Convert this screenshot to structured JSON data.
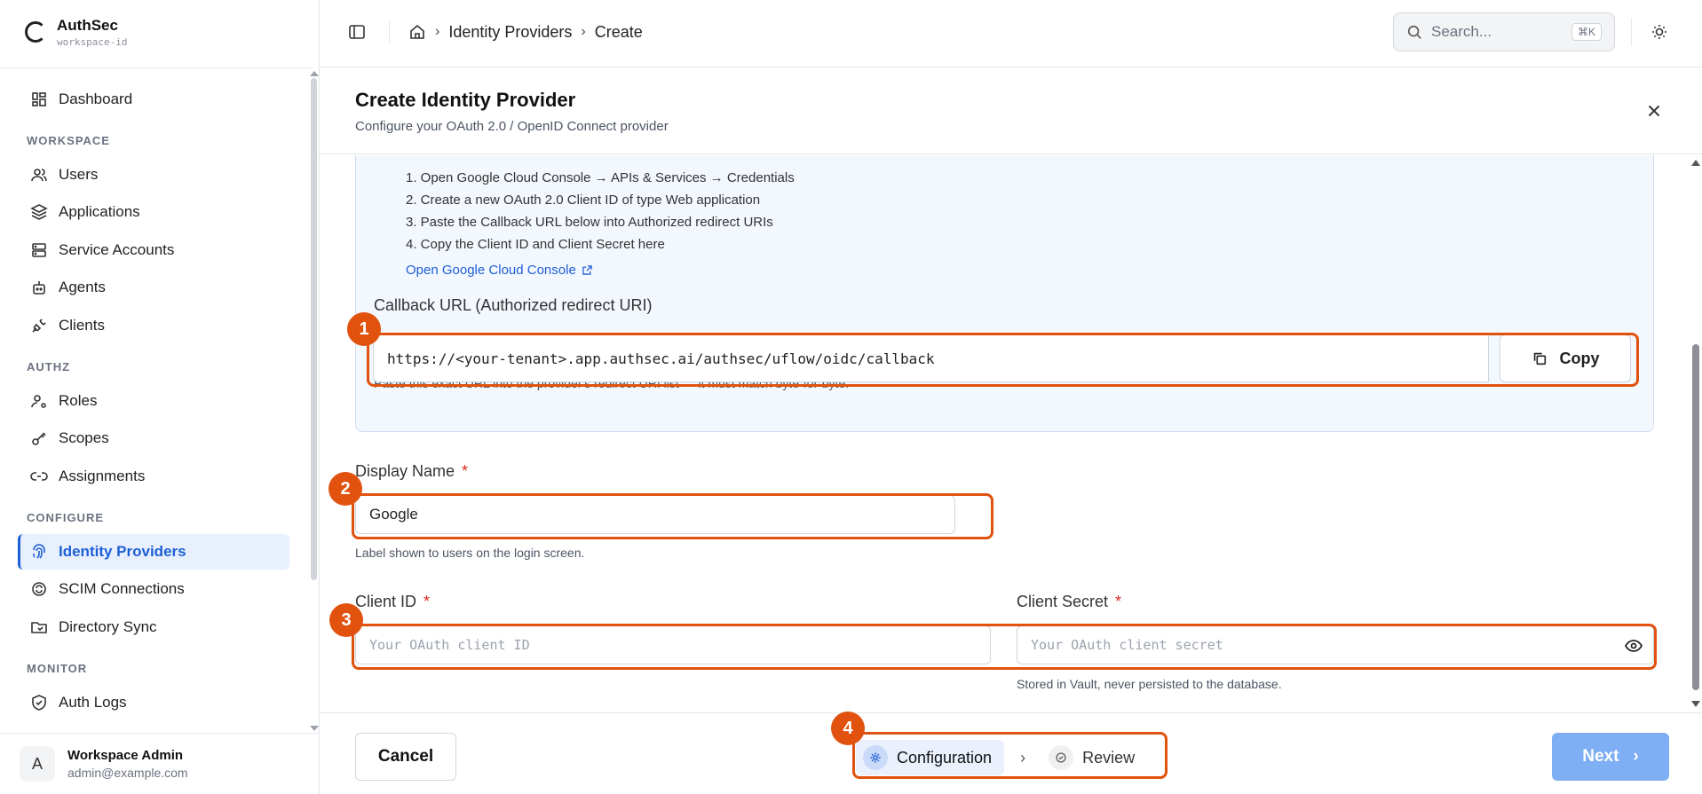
{
  "brand": {
    "name": "AuthSec",
    "workspace": "workspace-id"
  },
  "sidebar": {
    "dashboard": "Dashboard",
    "sections": {
      "workspace": "WORKSPACE",
      "authz": "AUTHZ",
      "configure": "CONFIGURE",
      "monitor": "MONITOR"
    },
    "items": {
      "users": "Users",
      "applications": "Applications",
      "service_accounts": "Service Accounts",
      "agents": "Agents",
      "clients": "Clients",
      "roles": "Roles",
      "scopes": "Scopes",
      "assignments": "Assignments",
      "identity_providers": "Identity Providers",
      "scim": "SCIM Connections",
      "directory_sync": "Directory Sync",
      "auth_logs": "Auth Logs"
    },
    "user": {
      "initial": "A",
      "name": "Workspace Admin",
      "email": "admin@example.com"
    }
  },
  "header": {
    "breadcrumb": [
      "Identity Providers",
      "Create"
    ],
    "search": {
      "placeholder": "Search...",
      "shortcut": "⌘K"
    }
  },
  "dialog": {
    "title": "Create Identity Provider",
    "subtitle": "Configure your OAuth 2.0 / OpenID Connect provider",
    "steps": [
      "1. Open Google Cloud Console → APIs & Services → Credentials",
      "2. Create a new OAuth 2.0 Client ID of type Web application",
      "3. Paste the Callback URL below into Authorized redirect URIs",
      "4. Copy the Client ID and Client Secret here"
    ],
    "console_link": "Open Google Cloud Console",
    "callback": {
      "label": "Callback URL (Authorized redirect URI)",
      "value": "https://<your-tenant>.app.authsec.ai/authsec/uflow/oidc/callback",
      "copy_label": "Copy",
      "hint": "Paste this exact URL into the provider's redirect URI list — it must match byte-for-byte."
    },
    "display_name": {
      "label": "Display Name",
      "required": "*",
      "value": "Google",
      "hint": "Label shown to users on the login screen."
    },
    "client_id": {
      "label": "Client ID",
      "required": "*",
      "placeholder": "Your OAuth client ID"
    },
    "client_secret": {
      "label": "Client Secret",
      "required": "*",
      "placeholder": "Your OAuth client secret",
      "hint": "Stored in Vault, never persisted to the database."
    }
  },
  "footer": {
    "cancel": "Cancel",
    "wizard_steps": [
      "Configuration",
      "Review"
    ],
    "next": "Next"
  },
  "annotations": [
    "1",
    "2",
    "3",
    "4"
  ],
  "colors": {
    "accent": "#1d5fd6",
    "annotation": "#e1520f",
    "next_button": "#7eaef3",
    "required": "#d92d20"
  }
}
